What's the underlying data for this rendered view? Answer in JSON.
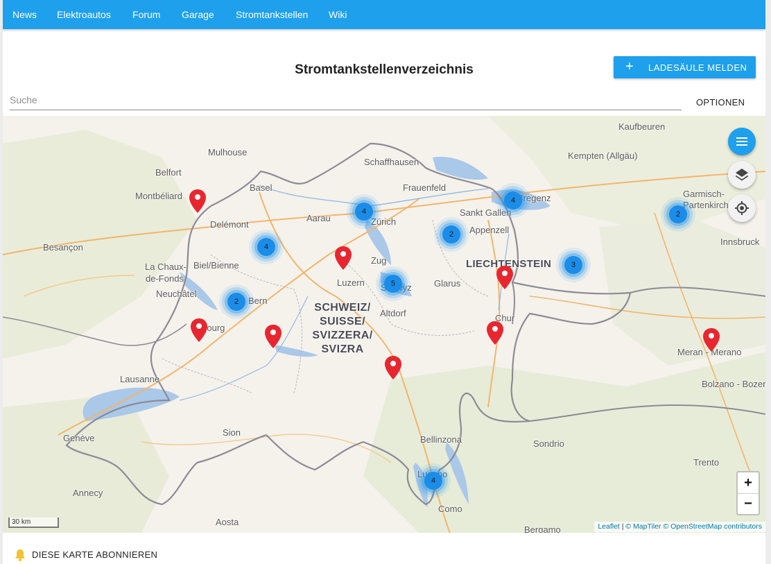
{
  "nav": {
    "items": [
      "News",
      "Elektroautos",
      "Forum",
      "Garage",
      "Stromtankstellen",
      "Wiki"
    ]
  },
  "header": {
    "title": "Stromtankstellenverzeichnis",
    "report_button": {
      "icon": "plus-icon",
      "label": "LADESÄULE MELDEN"
    }
  },
  "search": {
    "placeholder": "Suche",
    "value": ""
  },
  "options_label": "OPTIONEN",
  "map": {
    "country_label": [
      "SCHWEIZ/",
      "SUISSE/",
      "SVIZZERA/",
      "SVIZRA"
    ],
    "principality_label": "LIECHTENSTEIN",
    "places": {
      "kaufbeuren": "Kaufbeuren",
      "mulhouse": "Mulhouse",
      "schaffhausen": "Schaffhausen",
      "kempten": "Kempten (Allgäu)",
      "belfort": "Belfort",
      "basel": "Basel",
      "frauenfeld": "Frauenfeld",
      "montbeliard": "Montbéliard",
      "bregenz": "Bregenz",
      "garmisch": "Garmisch-",
      "partenkirchen": "Partenkirchen",
      "sankt_gallen": "Sankt Gallen",
      "aarau": "Aarau",
      "zurich": "Zürich",
      "delemont": "Delémont",
      "appenzell": "Appenzell",
      "innsbruck": "Innsbruck",
      "besancon": "Besançon",
      "zug": "Zug",
      "biel": "Biel/Bienne",
      "la_chaux": "La Chaux-",
      "de_fonds": "de-Fonds",
      "luzern": "Luzern",
      "schwyz": "Schwyz",
      "glarus": "Glarus",
      "neuchatel": "Neuchâtel",
      "bern": "Bern",
      "altdorf": "Altdorf",
      "chur": "Chur",
      "fribourg": "Fribourg",
      "meran": "Meran - Merano",
      "lausanne": "Lausanne",
      "bolzano": "Bolzano - Bozen",
      "geneve": "Genève",
      "sion": "Sion",
      "bellinzona": "Bellinzona",
      "sondrio": "Sondrio",
      "trento": "Trento",
      "lugano": "Lugano",
      "annecy": "Annecy",
      "aosta": "Aosta",
      "como": "Como",
      "bergamo": "Bergamo"
    },
    "clusters": {
      "zurich": "4",
      "bregenz": "4",
      "garmisch": "2",
      "sankt_gallen": "2",
      "delemont": "4",
      "liechtenstein": "3",
      "schwyz": "5",
      "bern": "2",
      "lugano": "4"
    },
    "scale_label": "30 km",
    "attribution": {
      "leaflet": "Leaflet",
      "separator": " | ",
      "maptiler": "© MapTiler",
      "osm": "© OpenStreetMap contributors"
    }
  },
  "controls": {
    "menu_icon": "menu-icon",
    "layers_icon": "layers-icon",
    "locate_icon": "locate-icon",
    "zoom_in": "+",
    "zoom_out": "−"
  },
  "subscribe": {
    "icon": "bell-icon",
    "label": "DIESE KARTE ABONNIEREN"
  },
  "colors": {
    "primary": "#1ea0ec",
    "cluster": "#1b8ce8",
    "marker": "#e8262f",
    "border": "#8c8a96",
    "lake": "#aac8e8",
    "road": "#f3b56a"
  }
}
